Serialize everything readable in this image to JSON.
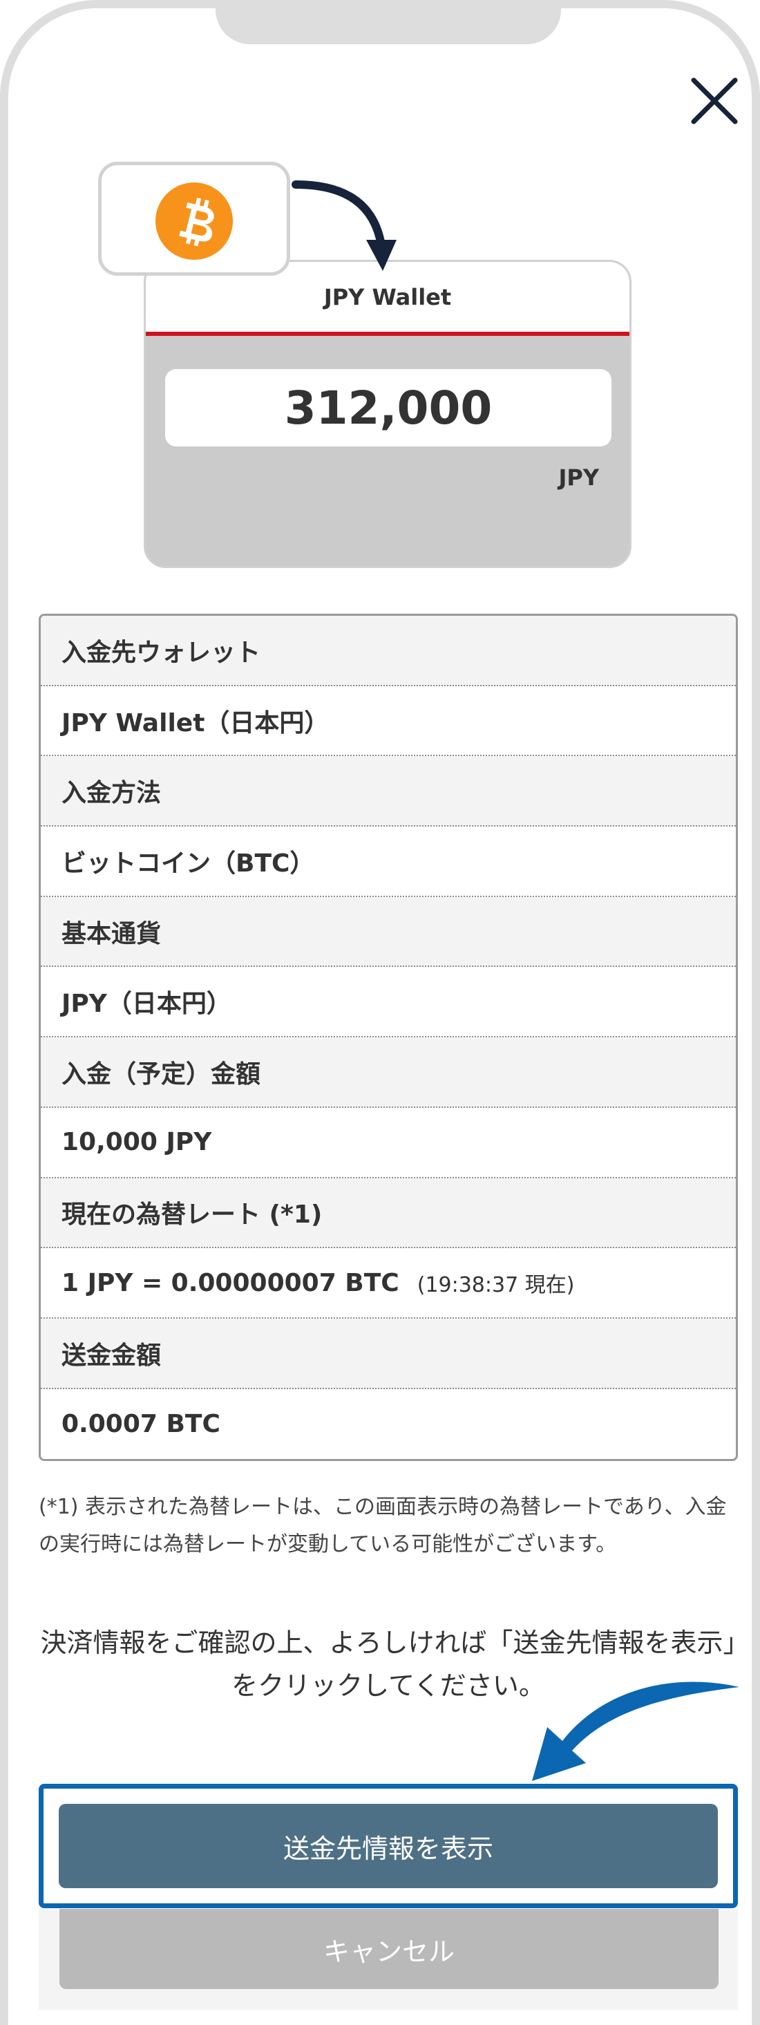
{
  "wallet_card": {
    "title": "JPY Wallet",
    "balance": "312,000",
    "currency": "JPY"
  },
  "source_icon": "bitcoin-icon",
  "details": [
    {
      "kind": "label",
      "text": "入金先ウォレット"
    },
    {
      "kind": "value",
      "text": "JPY Wallet（日本円）"
    },
    {
      "kind": "label",
      "text": "入金方法"
    },
    {
      "kind": "value",
      "text": "ビットコイン（BTC）"
    },
    {
      "kind": "label",
      "text": "基本通貨"
    },
    {
      "kind": "value",
      "text": "JPY（日本円）"
    },
    {
      "kind": "label",
      "text": "入金（予定）金額"
    },
    {
      "kind": "value",
      "text": "10,000 JPY"
    },
    {
      "kind": "label",
      "text": "現在の為替レート (*1)"
    },
    {
      "kind": "value",
      "text": "1 JPY = 0.00000007 BTC",
      "sub": "(19:38:37 現在)"
    },
    {
      "kind": "label",
      "text": "送金金額"
    },
    {
      "kind": "value",
      "text": "0.0007 BTC"
    }
  ],
  "footnote": "(*1)  表示された為替レートは、この画面表示時の為替レートであり、入金の実行時には為替レートが変動している可能性がございます。",
  "instruction": "決済情報をご確認の上、よろしければ「送金先情報を表示」をクリックしてください。",
  "buttons": {
    "show_destination": "送金先情報を表示",
    "cancel": "キャンセル"
  },
  "colors": {
    "accent_red": "#d0121b",
    "highlight_blue": "#0b67b1",
    "primary_button": "#4e7086",
    "cancel_button": "#b9b9b9",
    "bitcoin_orange": "#f7931a"
  }
}
